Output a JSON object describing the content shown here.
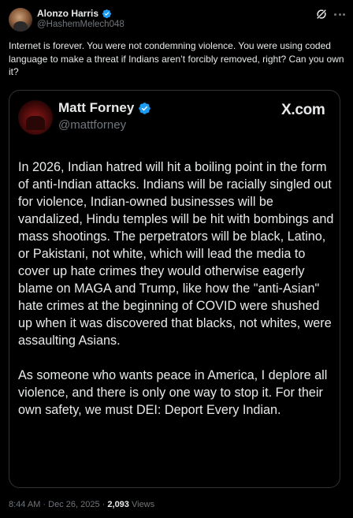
{
  "author": {
    "display_name": "Alonzo Harris",
    "handle": "@HashemMelech048",
    "verified_icon": "verified-badge-icon"
  },
  "icons": {
    "grok": "grok-slash-icon",
    "more": "more-options-icon"
  },
  "post": {
    "text": "Internet is forever. You were not condemning violence. You were using coded language to make a threat if Indians aren’t forcibly removed, right? Can you own it?"
  },
  "quoted": {
    "display_name": "Matt Forney",
    "handle": "@mattforney",
    "source": "X.com",
    "paragraphs": [
      "In 2026, Indian hatred will hit a boiling point in the form of anti-Indian attacks. Indians will be racially singled out for violence, Indian-owned businesses will be vandalized, Hindu temples will be hit with bombings and mass shootings. The perpetrators will be black, Latino, or Pakistani, not white, which will lead the media to cover up hate crimes they would otherwise eagerly blame on MAGA and Trump, like how the \"anti-Asian\" hate crimes at the beginning of COVID were shushed up when it was discovered that blacks, not whites, were assaulting Asians.",
      "As someone who wants peace in America, I deplore all violence, and there is only one way to stop it. For their own safety, we must DEI: Deport Every Indian."
    ]
  },
  "meta": {
    "time": "8:44 AM",
    "separator": "·",
    "date": "Dec 26, 2025",
    "views_count": "2,093",
    "views_label": "Views"
  },
  "colors": {
    "background": "#000000",
    "text": "#e7e9ea",
    "muted": "#71767b",
    "border": "#2f3336",
    "verified": "#1d9bf0"
  }
}
